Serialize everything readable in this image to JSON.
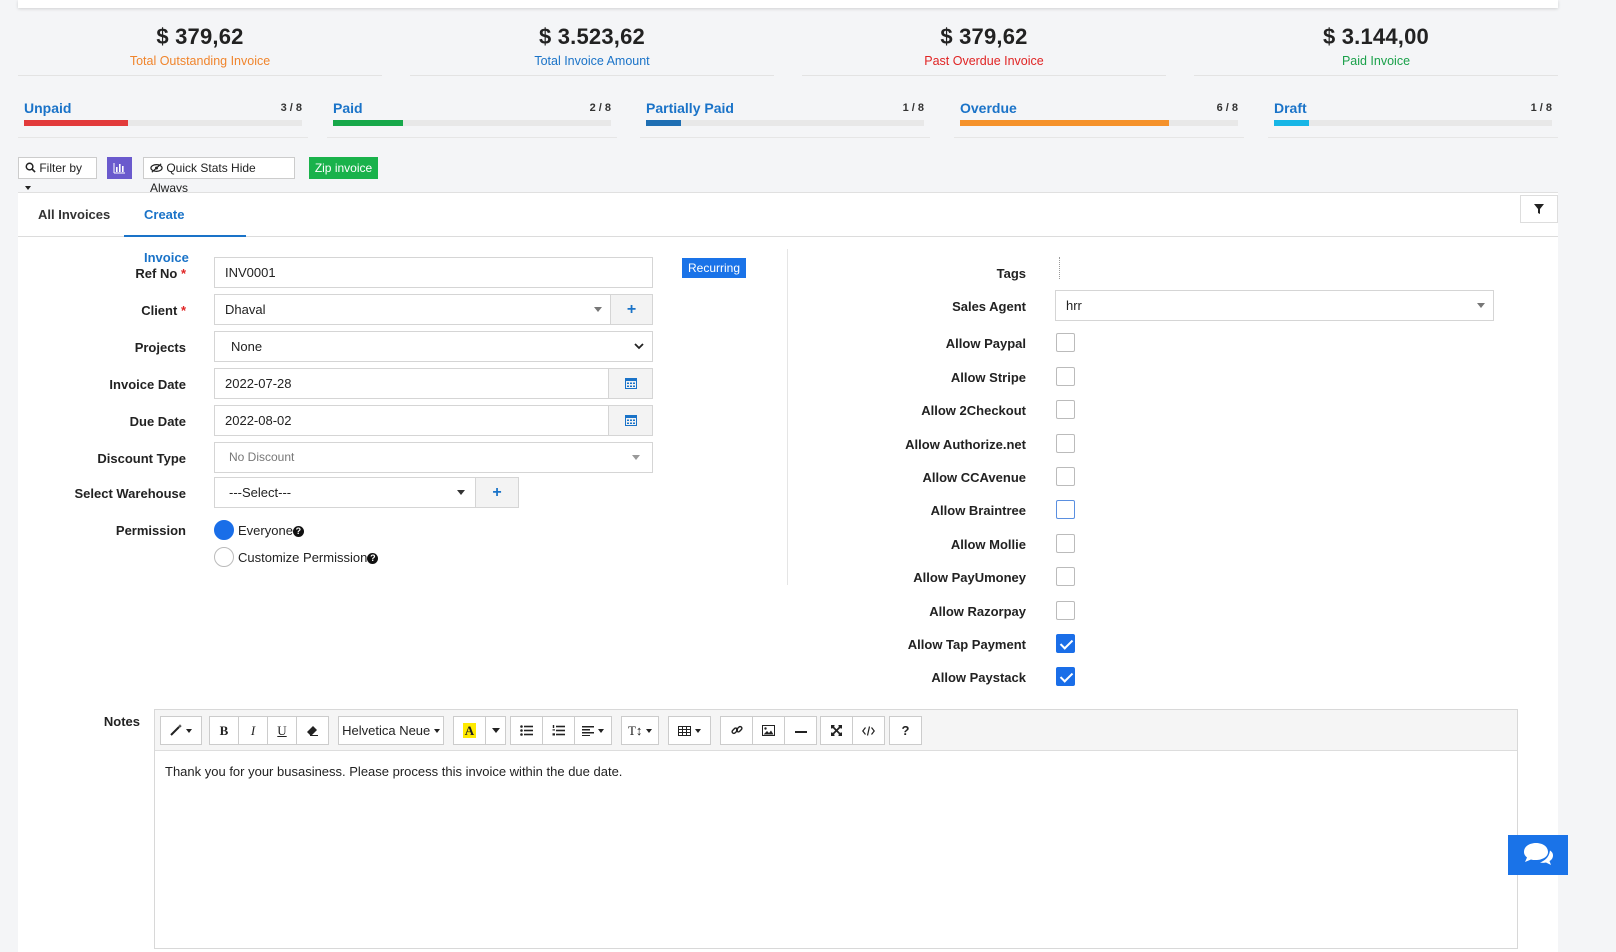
{
  "stats": [
    {
      "amount": "$ 379,62",
      "label": "Total Outstanding Invoice",
      "color": "#f0852d"
    },
    {
      "amount": "$ 3.523,62",
      "label": "Total Invoice Amount",
      "color": "#1a73c8"
    },
    {
      "amount": "$ 379,62",
      "label": "Past Overdue Invoice",
      "color": "#e02424"
    },
    {
      "amount": "$ 3.144,00",
      "label": "Paid Invoice",
      "color": "#1aa14a"
    }
  ],
  "progress": [
    {
      "name": "Unpaid",
      "count": "3 / 8",
      "fraction": 0.375,
      "color": "#e23b3b"
    },
    {
      "name": "Paid",
      "count": "2 / 8",
      "fraction": 0.25,
      "color": "#17a84a"
    },
    {
      "name": "Partially Paid",
      "count": "1 / 8",
      "fraction": 0.125,
      "color": "#1f6fb3"
    },
    {
      "name": "Overdue",
      "count": "6 / 8",
      "fraction": 0.75,
      "color": "#f5922b"
    },
    {
      "name": "Draft",
      "count": "1 / 8",
      "fraction": 0.125,
      "color": "#17b6e6"
    }
  ],
  "toolbar": {
    "filter_label": "Filter by",
    "quick_stats_label": "Quick Stats Hide Always",
    "zip_label": "Zip invoice"
  },
  "tabs": {
    "all": "All Invoices",
    "create": "Create Invoice"
  },
  "form": {
    "ref_label": "Ref No",
    "ref_value": "INV0001",
    "recurring_label": "Recurring",
    "client_label": "Client",
    "client_value": "Dhaval",
    "projects_label": "Projects",
    "projects_value": "None",
    "invoice_date_label": "Invoice Date",
    "invoice_date_value": "2022-07-28",
    "due_date_label": "Due Date",
    "due_date_value": "2022-08-02",
    "discount_label": "Discount Type",
    "discount_value": "No Discount",
    "warehouse_label": "Select Warehouse",
    "warehouse_value": "---Select---",
    "permission_label": "Permission",
    "perm_everyone": "Everyone",
    "perm_custom": "Customize Permission",
    "required_mark": "*"
  },
  "right": {
    "tags_label": "Tags",
    "agent_label": "Sales Agent",
    "agent_value": "hrr",
    "payments": [
      {
        "label": "Allow Paypal",
        "checked": false
      },
      {
        "label": "Allow Stripe",
        "checked": false
      },
      {
        "label": "Allow 2Checkout",
        "checked": false
      },
      {
        "label": "Allow Authorize.net",
        "checked": false
      },
      {
        "label": "Allow CCAvenue",
        "checked": false
      },
      {
        "label": "Allow Braintree",
        "checked": false
      },
      {
        "label": "Allow Mollie",
        "checked": false
      },
      {
        "label": "Allow PayUmoney",
        "checked": false
      },
      {
        "label": "Allow Razorpay",
        "checked": false
      },
      {
        "label": "Allow Tap Payment",
        "checked": true
      },
      {
        "label": "Allow Paystack",
        "checked": true
      }
    ]
  },
  "notes": {
    "label": "Notes",
    "font_name": "Helvetica Neue",
    "body": "Thank you for your busasiness. Please process this invoice within the due date."
  }
}
